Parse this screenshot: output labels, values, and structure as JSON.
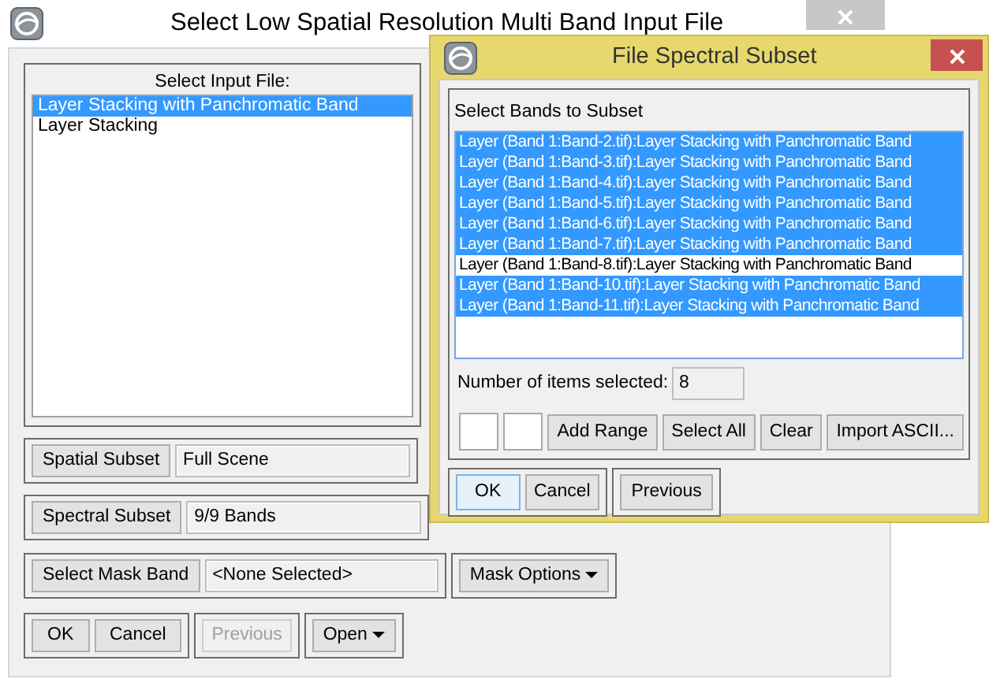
{
  "main_window": {
    "title": "Select Low Spatial Resolution Multi Band Input File",
    "input_file": {
      "label": "Select Input File:",
      "items": [
        {
          "text": "Layer Stacking with Panchromatic Band",
          "selected": true
        },
        {
          "text": "Layer Stacking",
          "selected": false
        }
      ]
    },
    "spatial_subset": {
      "button": "Spatial Subset",
      "value": "Full Scene"
    },
    "spectral_subset": {
      "button": "Spectral Subset",
      "value": "9/9 Bands"
    },
    "mask": {
      "button": "Select Mask Band",
      "value": "<None Selected>",
      "options_button": "Mask Options"
    },
    "buttons": [
      {
        "label": "OK",
        "disabled": false
      },
      {
        "label": "Cancel",
        "disabled": false
      }
    ],
    "previous_button": {
      "label": "Previous",
      "disabled": true
    },
    "open_button": "Open"
  },
  "dialog": {
    "title": "File Spectral Subset",
    "list_label": "Select Bands to Subset",
    "bands": [
      {
        "text": "Layer (Band 1:Band-2.tif):Layer Stacking with Panchromatic Band",
        "selected": true
      },
      {
        "text": "Layer (Band 1:Band-3.tif):Layer Stacking with Panchromatic Band",
        "selected": true
      },
      {
        "text": "Layer (Band 1:Band-4.tif):Layer Stacking with Panchromatic Band",
        "selected": true
      },
      {
        "text": "Layer (Band 1:Band-5.tif):Layer Stacking with Panchromatic Band",
        "selected": true
      },
      {
        "text": "Layer (Band 1:Band-6.tif):Layer Stacking with Panchromatic Band",
        "selected": true
      },
      {
        "text": "Layer (Band 1:Band-7.tif):Layer Stacking with Panchromatic Band",
        "selected": true
      },
      {
        "text": "Layer (Band 1:Band-8.tif):Layer Stacking with Panchromatic Band",
        "selected": false
      },
      {
        "text": "Layer (Band 1:Band-10.tif):Layer Stacking with Panchromatic Band",
        "selected": true
      },
      {
        "text": "Layer (Band 1:Band-11.tif):Layer Stacking with Panchromatic Band",
        "selected": true
      }
    ],
    "count_label": "Number of items selected:",
    "count_value": "8",
    "range_buttons": [
      "Add Range",
      "Select All",
      "Clear",
      "Import ASCII..."
    ],
    "buttons": [
      {
        "label": "OK",
        "focused": true
      },
      {
        "label": "Cancel",
        "focused": false
      }
    ],
    "previous_button": "Previous"
  }
}
